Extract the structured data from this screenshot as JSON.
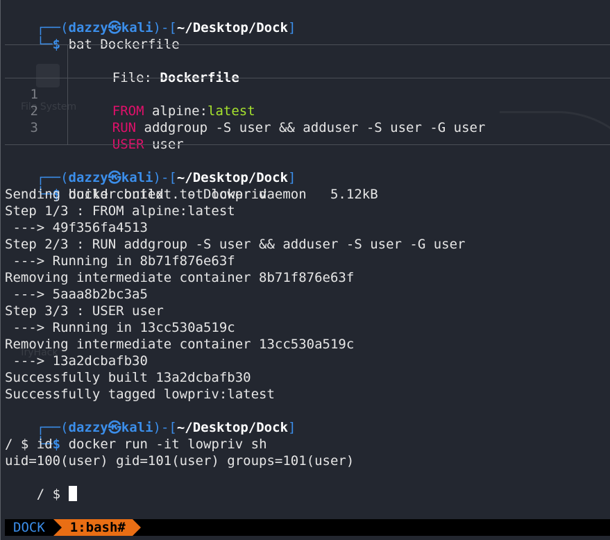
{
  "prompt": {
    "user": "dazzy",
    "host_symbol": "㉿",
    "host": "kali",
    "dir": "~/Desktop/Dock",
    "dollar": "$"
  },
  "commands": {
    "bat": "bat Dockerfile",
    "build": "docker build . -t lowpriv",
    "run": "docker run -it lowpriv sh"
  },
  "bat": {
    "file_label": "File: ",
    "file_name": "Dockerfile",
    "lines": [
      {
        "num": "1",
        "kw": "FROM",
        "rest_a": " alpine:",
        "rest_b": "latest"
      },
      {
        "num": "2",
        "kw": "RUN",
        "rest_a": " addgroup -S user && adduser -S user -G user",
        "rest_b": ""
      },
      {
        "num": "3",
        "kw": "USER",
        "rest_a": " user",
        "rest_b": ""
      }
    ]
  },
  "build_output": [
    "Sending build context to Docker daemon   5.12kB",
    "Step 1/3 : FROM alpine:latest",
    " ---> 49f356fa4513",
    "Step 2/3 : RUN addgroup -S user && adduser -S user -G user",
    " ---> Running in 8b71f876e63f",
    "Removing intermediate container 8b71f876e63f",
    " ---> 5aaa8b2bc3a5",
    "Step 3/3 : USER user",
    " ---> Running in 13cc530a519c",
    "Removing intermediate container 13cc530a519c",
    " ---> 13a2dcbafb30",
    "Successfully built 13a2dcbafb30",
    "Successfully tagged lowpriv:latest"
  ],
  "shell": {
    "line1": "/ $ id",
    "line2": "uid=100(user) gid=101(user) groups=101(user)",
    "line3": "/ $ "
  },
  "background": {
    "ghost_1": "File System",
    "ghost_2": "TryHack"
  },
  "statusbar": {
    "session": "DOCK",
    "window": "1:bash#"
  },
  "colors": {
    "background": "#232730",
    "prompt": "#3b8eea",
    "keyword": "#e0106a",
    "string": "#a6e22e",
    "status_tab": "#e96e14"
  }
}
